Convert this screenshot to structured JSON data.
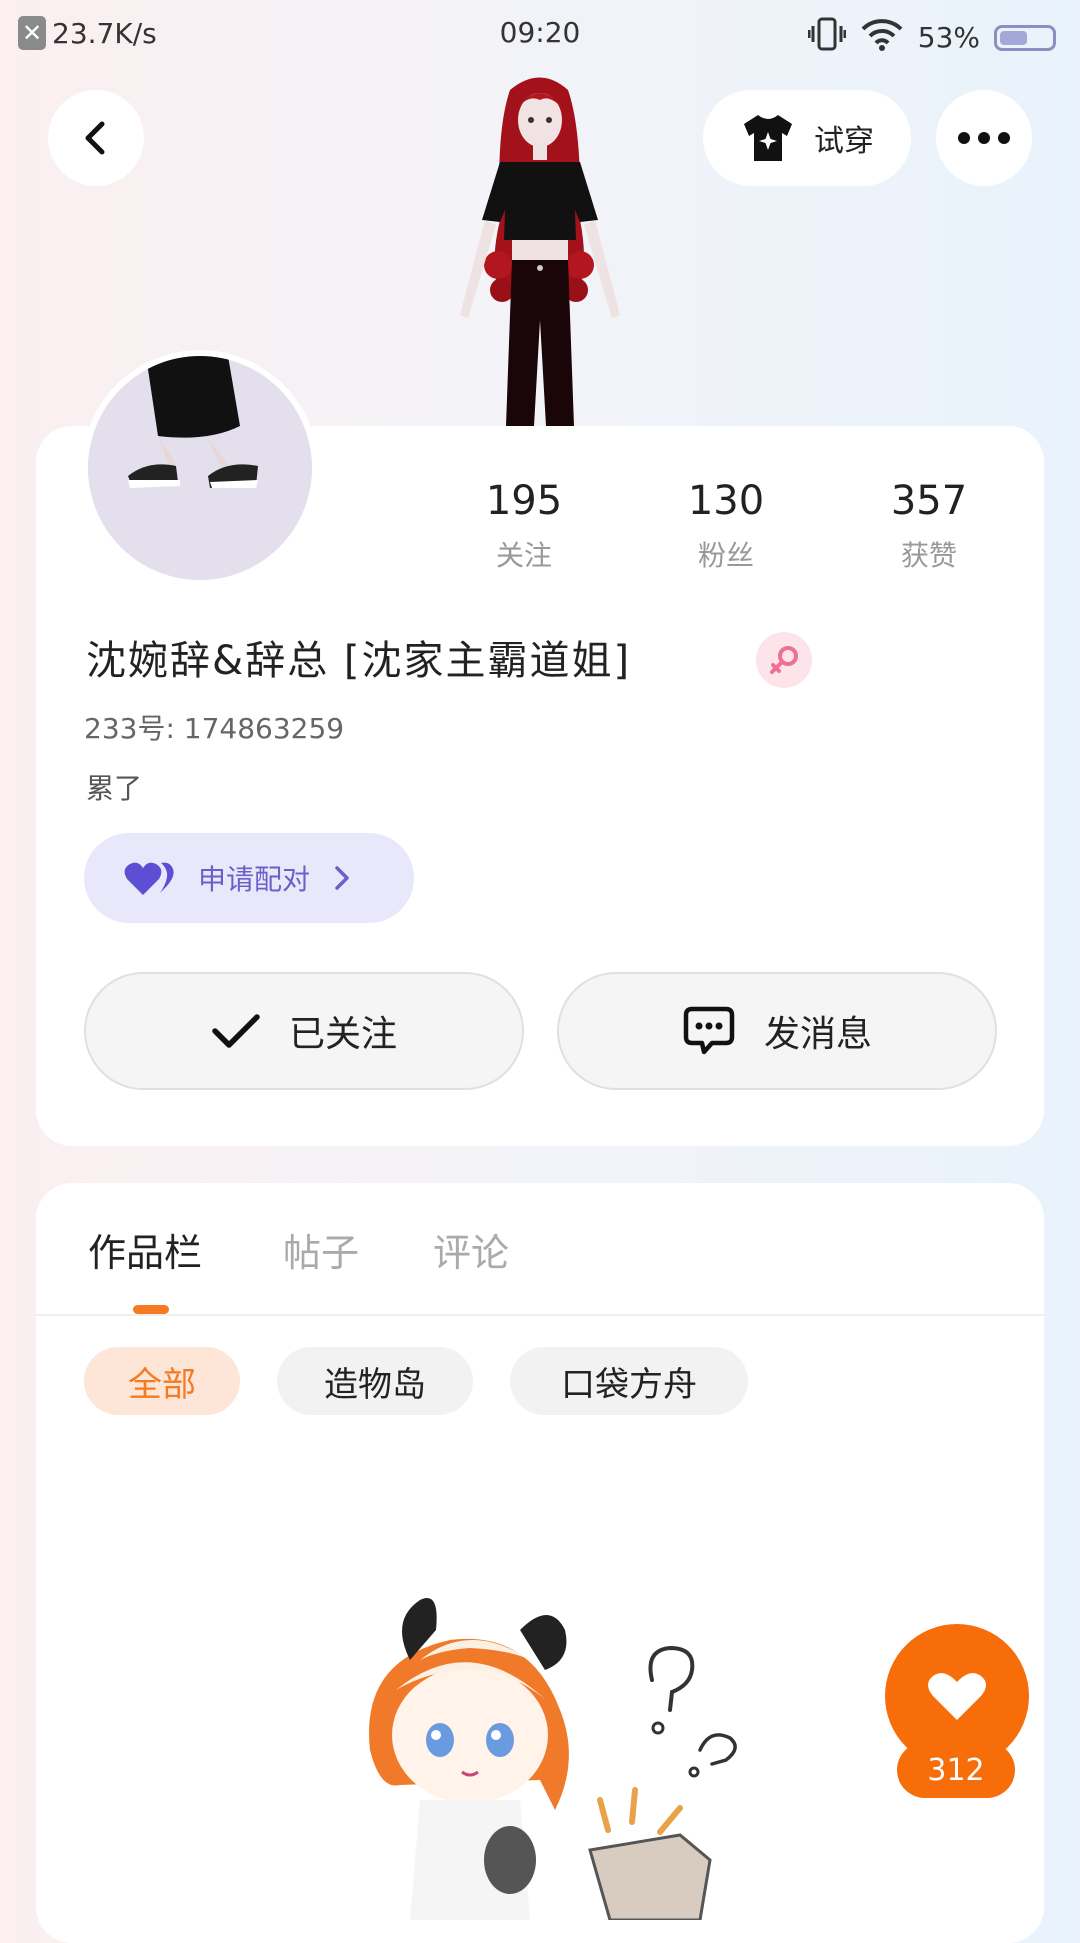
{
  "status_bar": {
    "net_speed": "23.7K/s",
    "time": "09:20",
    "battery_percent": "53%",
    "battery_level": 0.53
  },
  "header": {
    "try_on_label": "试穿"
  },
  "profile": {
    "stats": [
      {
        "value": "195",
        "label": "关注"
      },
      {
        "value": "130",
        "label": "粉丝"
      },
      {
        "value": "357",
        "label": "获赞"
      }
    ],
    "name": "沈婉辞&辞总 [沈家主霸道姐]",
    "id_line": "233号: 174863259",
    "signature": "累了",
    "pair_button_label": "申请配对",
    "followed_label": "已关注",
    "message_label": "发消息"
  },
  "content": {
    "tabs": [
      {
        "label": "作品栏",
        "active": true
      },
      {
        "label": "帖子",
        "active": false
      },
      {
        "label": "评论",
        "active": false
      }
    ],
    "filters": [
      {
        "label": "全部",
        "active": true
      },
      {
        "label": "造物岛",
        "active": false
      },
      {
        "label": "口袋方舟",
        "active": false
      }
    ]
  },
  "like": {
    "count": "312"
  },
  "colors": {
    "accent": "#f76d0a",
    "pair_bg": "#e9e8fb",
    "pair_text": "#6a61c8",
    "gender_female": "#ef6f95"
  }
}
